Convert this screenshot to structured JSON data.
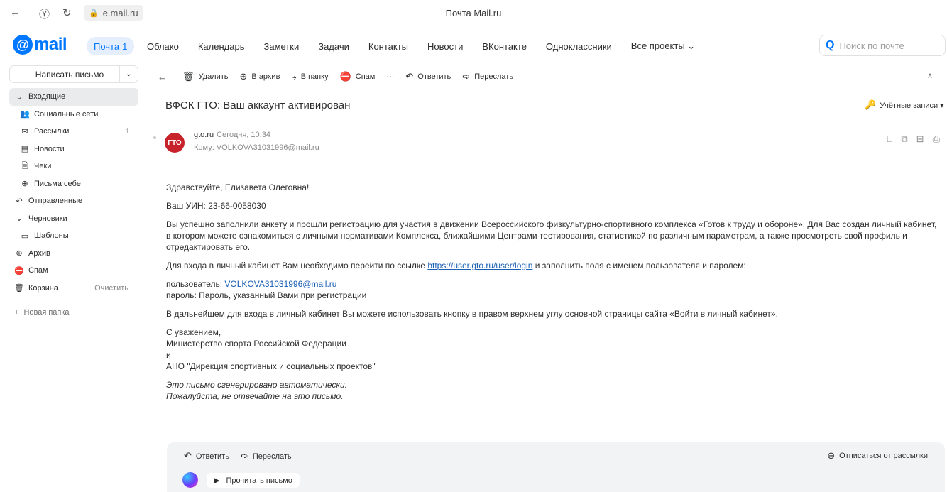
{
  "browser": {
    "url": "e.mail.ru",
    "window_title": "Почта Mail.ru",
    "back_icon": "←",
    "yandex_icon": "Ⓨ",
    "reload_icon": "↻"
  },
  "nav": {
    "logo_text": "mail",
    "mail_label": "Почта",
    "mail_count": "1",
    "links": [
      "Облако",
      "Календарь",
      "Заметки",
      "Задачи",
      "Контакты",
      "Новости",
      "ВКонтакте",
      "Одноклассники",
      "Все проекты ⌄"
    ],
    "search_placeholder": "Поиск по почте"
  },
  "sidebar": {
    "compose": "Написать письмо",
    "folders": [
      {
        "label": "Входящие",
        "icon": "⌄"
      },
      {
        "label": "Социальные сети",
        "icon": "👥"
      },
      {
        "label": "Рассылки",
        "icon": "✉",
        "count": "1"
      },
      {
        "label": "Новости",
        "icon": "▤"
      },
      {
        "label": "Чеки",
        "icon": "🗎"
      },
      {
        "label": "Письма себе",
        "icon": "⊕"
      },
      {
        "label": "Отправленные",
        "icon": "↶"
      },
      {
        "label": "Черновики",
        "icon": "⌄"
      },
      {
        "label": "Шаблоны",
        "icon": "▭"
      },
      {
        "label": "Архив",
        "icon": "⊕"
      },
      {
        "label": "Спам",
        "icon": "⛔"
      },
      {
        "label": "Корзина",
        "icon": "🗑",
        "action": "Очистить"
      }
    ],
    "new_folder": "Новая папка"
  },
  "toolbar": {
    "delete": "Удалить",
    "archive": "В архив",
    "to_folder": "В папку",
    "spam": "Спам",
    "more": "···",
    "reply": "Ответить",
    "forward": "Переслать"
  },
  "message": {
    "subject": "ВФСК ГТО: Ваш аккаунт активирован",
    "accounts": "Учётные записи ▾",
    "avatar": "ГТО",
    "sender": "gto.ru",
    "date": "Сегодня, 10:34",
    "to": "Кому: VOLKOVA31031996@mail.ru",
    "greeting": "Здравствуйте, Елизавета Олеговна!",
    "uin": "Ваш УИН: 23-66-0058030",
    "para1": "Вы успешно заполнили анкету и прошли регистрацию для участия в движении Всероссийского физкультурно-спортивного комплекса «Готов к труду и обороне». Для Вас создан личный кабинет, в котором можете ознакомиться с личными нормативами Комплекса, ближайшими Центрами тестирования, статистикой по различным параметрам, а также просмотреть свой профиль и отредактировать его.",
    "para2_pre": "Для входа в личный кабинет Вам необходимо перейти по ссылке ",
    "para2_link": "https://user.gto.ru/user/login",
    "para2_post": " и заполнить поля с именем пользователя и паролем:",
    "user_label": "пользователь: ",
    "user_link": "VOLKOVA31031996@mail.ru",
    "password": "пароль: Пароль, указанный Вами при регистрации",
    "para3": "В дальнейшем для входа в личный кабинет Вы можете использовать кнопку в правом верхнем углу основной страницы сайта «Войти в личный кабинет».",
    "sig1": "С уважением,",
    "sig2": "Министерство спорта Российской Федерации",
    "sig3": "и",
    "sig4": "АНО \"Дирекция спортивных и социальных проектов\"",
    "auto1": "Это письмо сгенерировано автоматически.",
    "auto2": "Пожалуйста, не отвечайте на это письмо."
  },
  "footer": {
    "reply": "Ответить",
    "forward": "Переслать",
    "unsubscribe": "Отписаться от рассылки",
    "read": "Прочитать письмо"
  }
}
